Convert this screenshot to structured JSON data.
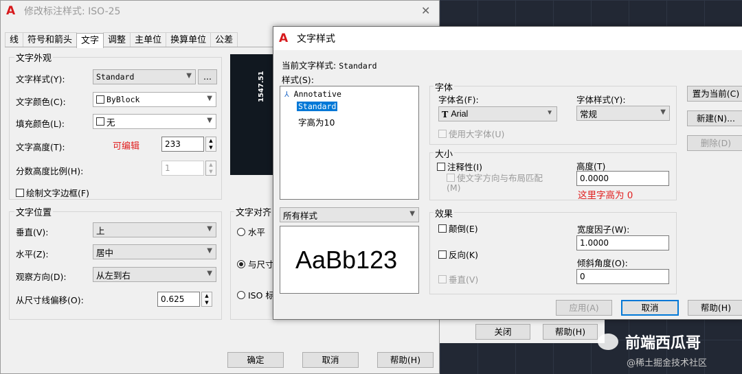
{
  "colors": {
    "accent": "#0078d7",
    "red_note": "#e02020",
    "logo": "#d7191c"
  },
  "back": {
    "title": "修改标注样式: ISO-25",
    "close": "✕",
    "tabs": [
      "线",
      "符号和箭头",
      "文字",
      "调整",
      "主单位",
      "换算单位",
      "公差"
    ],
    "appearance": {
      "group": "文字外观",
      "style_label": "文字样式(Y):",
      "style_value": "Standard",
      "dots": "...",
      "color_label": "文字颜色(C):",
      "color_value": "ByBlock",
      "fill_label": "填充颜色(L):",
      "fill_value": "无",
      "height_label": "文字高度(T):",
      "height_note": "可编辑",
      "height_value": "233",
      "frac_label": "分数高度比例(H):",
      "frac_value": "1",
      "frame_label": "绘制文字边框(F)"
    },
    "preview_dim": "1547.51",
    "position": {
      "group": "文字位置",
      "vert_label": "垂直(V):",
      "vert_value": "上",
      "horiz_label": "水平(Z):",
      "horiz_value": "居中",
      "view_label": "观察方向(D):",
      "view_value": "从左到右",
      "offset_label": "从尺寸线偏移(O):",
      "offset_value": "0.625"
    },
    "align": {
      "group": "文字对齐",
      "r1": "水平",
      "r2": "与尺寸",
      "r3": "ISO 标"
    },
    "buttons": {
      "ok": "确定",
      "cancel": "取消",
      "help": "帮助(H)",
      "close": "关闭",
      "help2": "帮助(H)"
    }
  },
  "front": {
    "title": "文字样式",
    "current_label": "当前文字样式:",
    "current_value": "Standard",
    "styles_label": "样式(S):",
    "styles": [
      "Annotative",
      "Standard",
      "字高为10"
    ],
    "filter_value": "所有样式",
    "preview_text": "AaBb123",
    "font": {
      "group": "字体",
      "name_label": "字体名(F):",
      "name_value": "Arial",
      "style_label": "字体样式(Y):",
      "style_value": "常规",
      "bigfont": "使用大字体(U)"
    },
    "size": {
      "group": "大小",
      "annotative": "注释性(I)",
      "match": "使文字方向与布局匹配(M)",
      "height_label": "高度(T)",
      "height_value": "0.0000",
      "note": "这里字高为 0"
    },
    "effects": {
      "group": "效果",
      "upside": "颠倒(E)",
      "backwards": "反向(K)",
      "vertical": "垂直(V)",
      "width_label": "宽度因子(W):",
      "width_value": "1.0000",
      "oblique_label": "倾斜角度(O):",
      "oblique_value": "0"
    },
    "side_buttons": {
      "set_current": "置为当前(C)",
      "new": "新建(N)...",
      "delete": "删除(D)"
    },
    "bottom_buttons": {
      "apply": "应用(A)",
      "cancel": "取消",
      "help": "帮助(H)"
    }
  },
  "watermark": {
    "brand": "前端西瓜哥",
    "community": "@稀土掘金技术社区"
  }
}
